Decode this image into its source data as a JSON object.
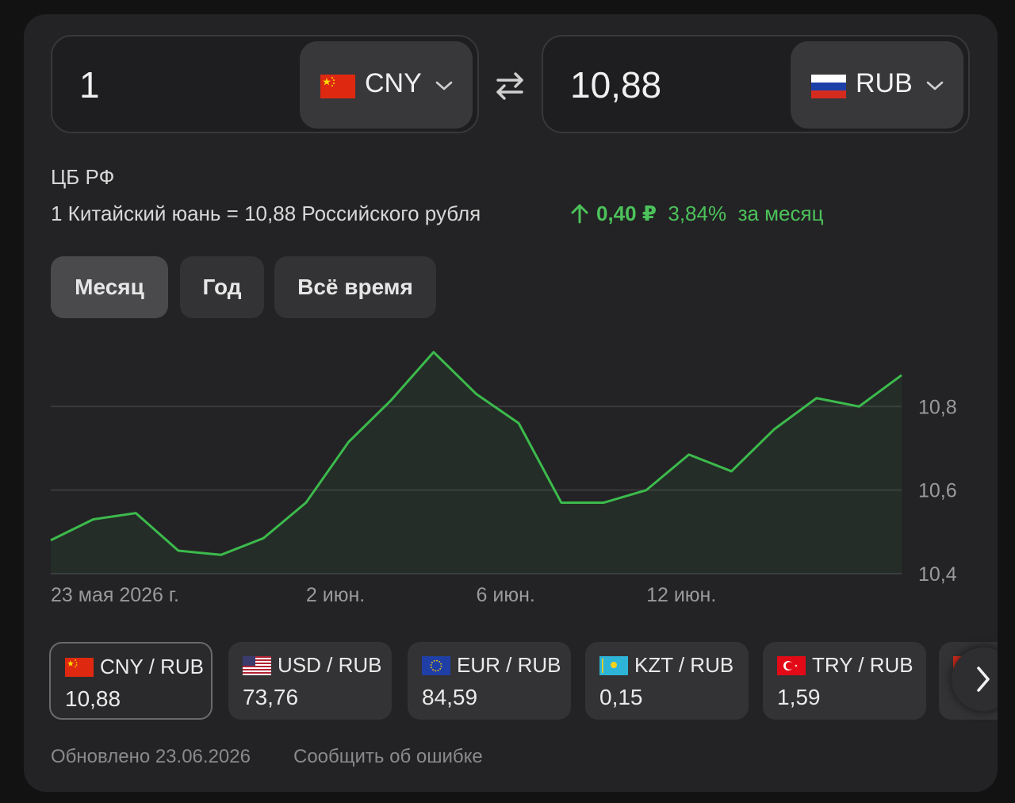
{
  "converter": {
    "from": {
      "amount": "1",
      "code": "CNY",
      "flag_icon": "china-flag-icon"
    },
    "to": {
      "amount": "10,88",
      "code": "RUB",
      "flag_icon": "russia-flag-icon"
    }
  },
  "source": "ЦБ РФ",
  "rate_text": "1 Китайский юань = 10,88 Российского рубля",
  "change": {
    "abs": "0,40 ₽",
    "pct": "3,84%",
    "period": "за месяц",
    "color": "#4cc25a"
  },
  "periods": [
    {
      "label": "Месяц",
      "active": true
    },
    {
      "label": "Год",
      "active": false
    },
    {
      "label": "Всё время",
      "active": false
    }
  ],
  "chart_data": {
    "type": "area",
    "x_labels": [
      "23 мая 2026 г.",
      "2 июн.",
      "6 июн.",
      "12 июн."
    ],
    "x_label_index": [
      0,
      6,
      10,
      14
    ],
    "values": [
      10.48,
      10.53,
      10.545,
      10.455,
      10.445,
      10.485,
      10.57,
      10.715,
      10.815,
      10.93,
      10.83,
      10.76,
      10.57,
      10.57,
      10.6,
      10.685,
      10.645,
      10.745,
      10.82,
      10.8,
      10.875
    ],
    "y_ticks": [
      "10,8",
      "10,6",
      "10,4"
    ],
    "y_tick_values": [
      10.8,
      10.6,
      10.4
    ],
    "ylim": [
      10.4,
      10.96
    ],
    "color": "#3cba4c"
  },
  "pairs": [
    {
      "name": "CNY / RUB",
      "value": "10,88",
      "flag_icon": "china-flag-icon"
    },
    {
      "name": "USD / RUB",
      "value": "73,76",
      "flag_icon": "usa-flag-icon"
    },
    {
      "name": "EUR / RUB",
      "value": "84,59",
      "flag_icon": "eu-flag-icon"
    },
    {
      "name": "KZT / RUB",
      "value": "0,15",
      "flag_icon": "kazakhstan-flag-icon"
    },
    {
      "name": "TRY / RUB",
      "value": "1,59",
      "flag_icon": "turkey-flag-icon"
    }
  ],
  "footer": {
    "updated": "Обновлено 23.06.2026",
    "report": "Сообщить об ошибке"
  }
}
